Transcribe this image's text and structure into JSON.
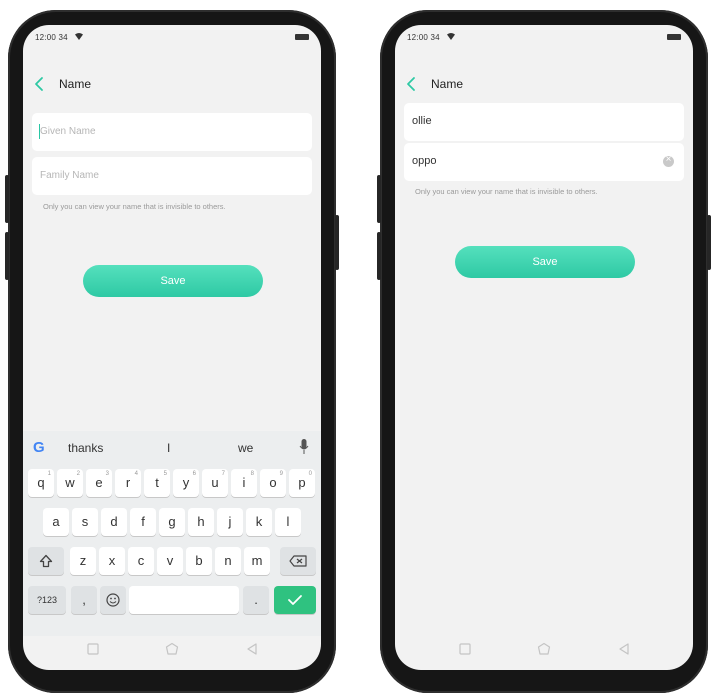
{
  "colors": {
    "accent": "#2ec9a4",
    "enter": "#2fc280",
    "screen_bg": "#f2f2f2",
    "frame": "#161616"
  },
  "left_screen": {
    "status": {
      "time": "12:00 34"
    },
    "header": {
      "title": "Name"
    },
    "given_name": {
      "value": "",
      "placeholder": "Given Name"
    },
    "family_name": {
      "value": "",
      "placeholder": "Family Name"
    },
    "hint": "Only you can view your name that is invisible to others.",
    "save_label": "Save",
    "keyboard": {
      "suggestions": [
        "thanks",
        "I",
        "we"
      ],
      "row1": [
        "q",
        "w",
        "e",
        "r",
        "t",
        "y",
        "u",
        "i",
        "o",
        "p"
      ],
      "row1_alt": [
        "1",
        "2",
        "3",
        "4",
        "5",
        "6",
        "7",
        "8",
        "9",
        "0"
      ],
      "row2": [
        "a",
        "s",
        "d",
        "f",
        "g",
        "h",
        "j",
        "k",
        "l"
      ],
      "row3": [
        "z",
        "x",
        "c",
        "v",
        "b",
        "n",
        "m"
      ],
      "symbols_label": "?123",
      "comma_label": ",",
      "period_label": "."
    }
  },
  "right_screen": {
    "status": {
      "time": "12:00 34"
    },
    "header": {
      "title": "Name"
    },
    "given_name": {
      "value": "ollie"
    },
    "family_name": {
      "value": "oppo"
    },
    "hint": "Only you can view your name that is invisible to others.",
    "save_label": "Save"
  }
}
